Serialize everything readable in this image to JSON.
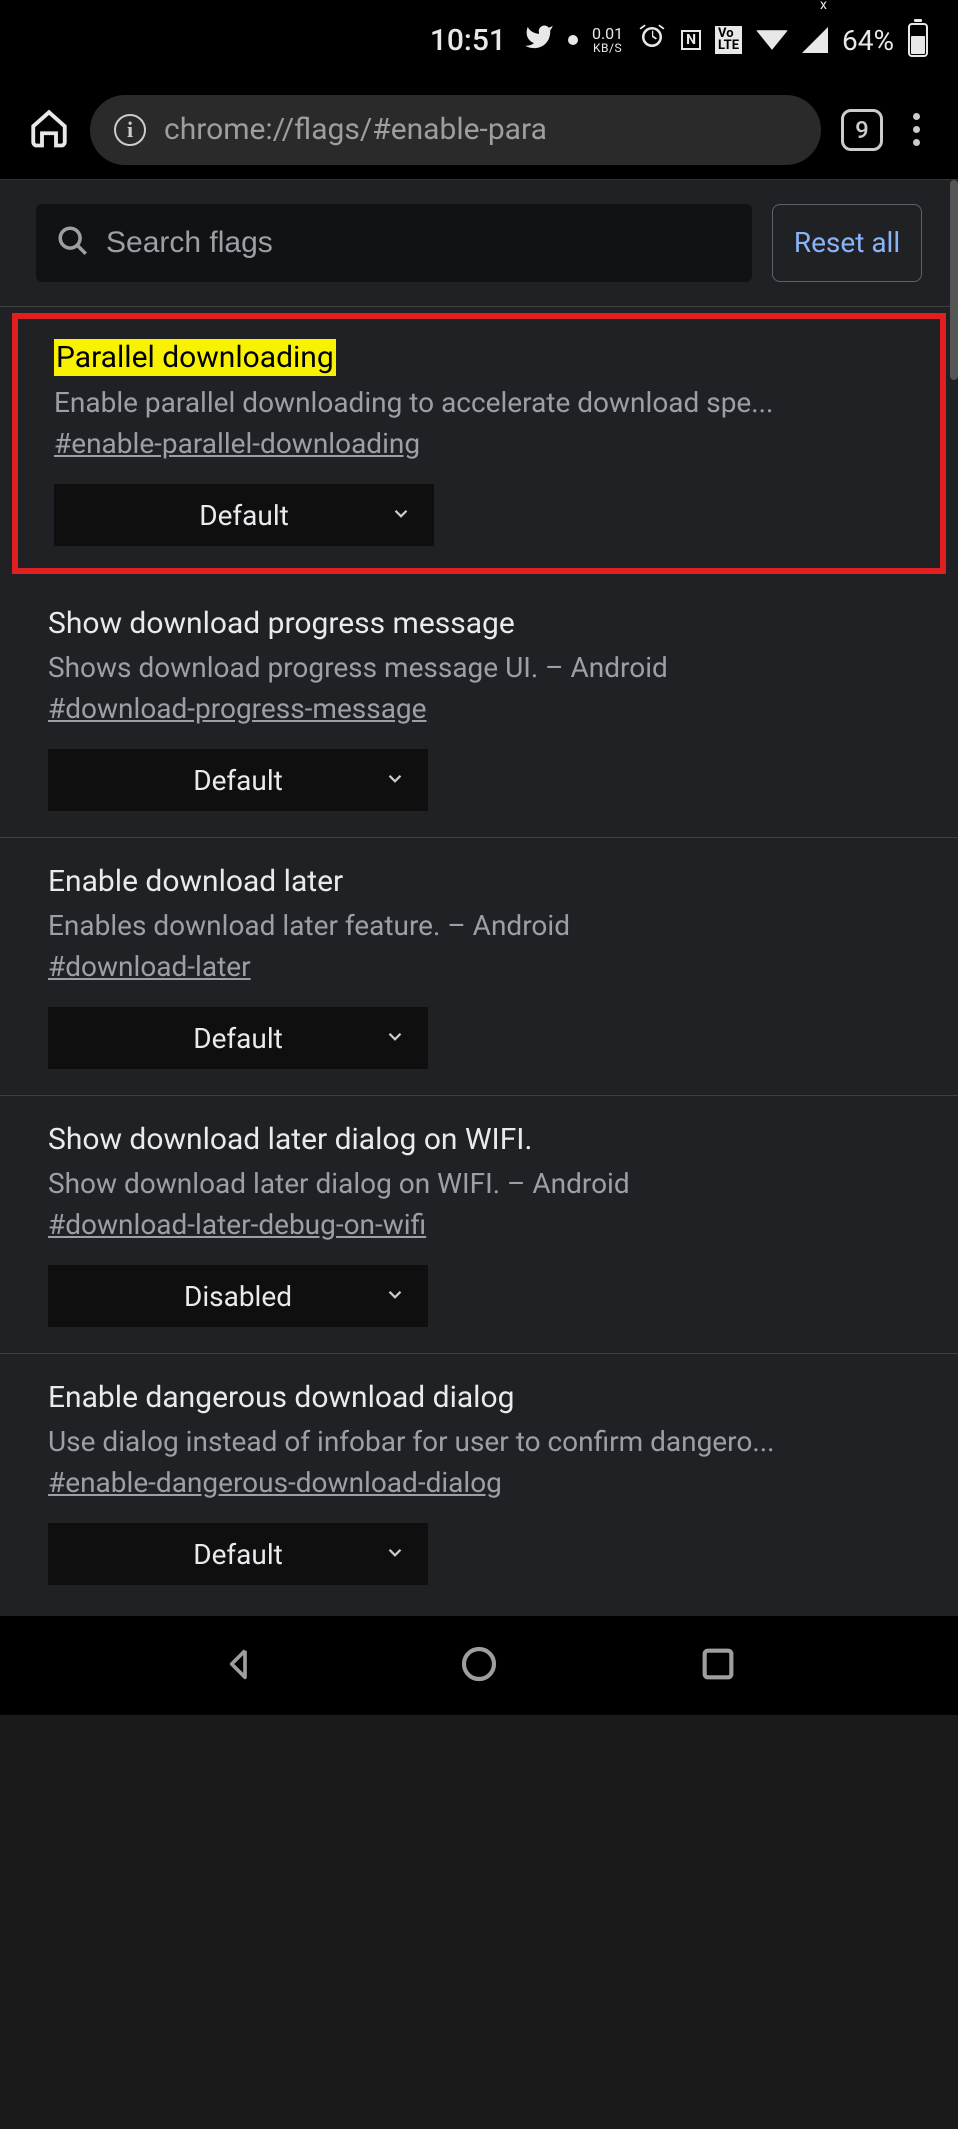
{
  "status": {
    "time": "10:51",
    "kbs_top": "0.01",
    "kbs_bottom": "KB/S",
    "nfc": "N",
    "volte": "Vo\nLTE",
    "battery_pct": "64%"
  },
  "browser": {
    "url": "chrome://flags/#enable-para",
    "tab_count": "9"
  },
  "search": {
    "placeholder": "Search flags",
    "reset_label": "Reset all"
  },
  "flags": [
    {
      "title": "Parallel downloading",
      "highlighted": true,
      "desc": "Enable parallel downloading to accelerate download spe...",
      "hash": "#enable-parallel-downloading",
      "value": "Default"
    },
    {
      "title": "Show download progress message",
      "desc": "Shows download progress message UI. – Android",
      "hash": "#download-progress-message",
      "value": "Default"
    },
    {
      "title": "Enable download later",
      "desc": "Enables download later feature. – Android",
      "hash": "#download-later",
      "value": "Default"
    },
    {
      "title": "Show download later dialog on WIFI.",
      "desc": "Show download later dialog on WIFI. – Android",
      "hash": "#download-later-debug-on-wifi",
      "value": "Disabled"
    },
    {
      "title": "Enable dangerous download dialog",
      "desc": "Use dialog instead of infobar for user to confirm dangero...",
      "hash": "#enable-dangerous-download-dialog",
      "value": "Default"
    }
  ]
}
